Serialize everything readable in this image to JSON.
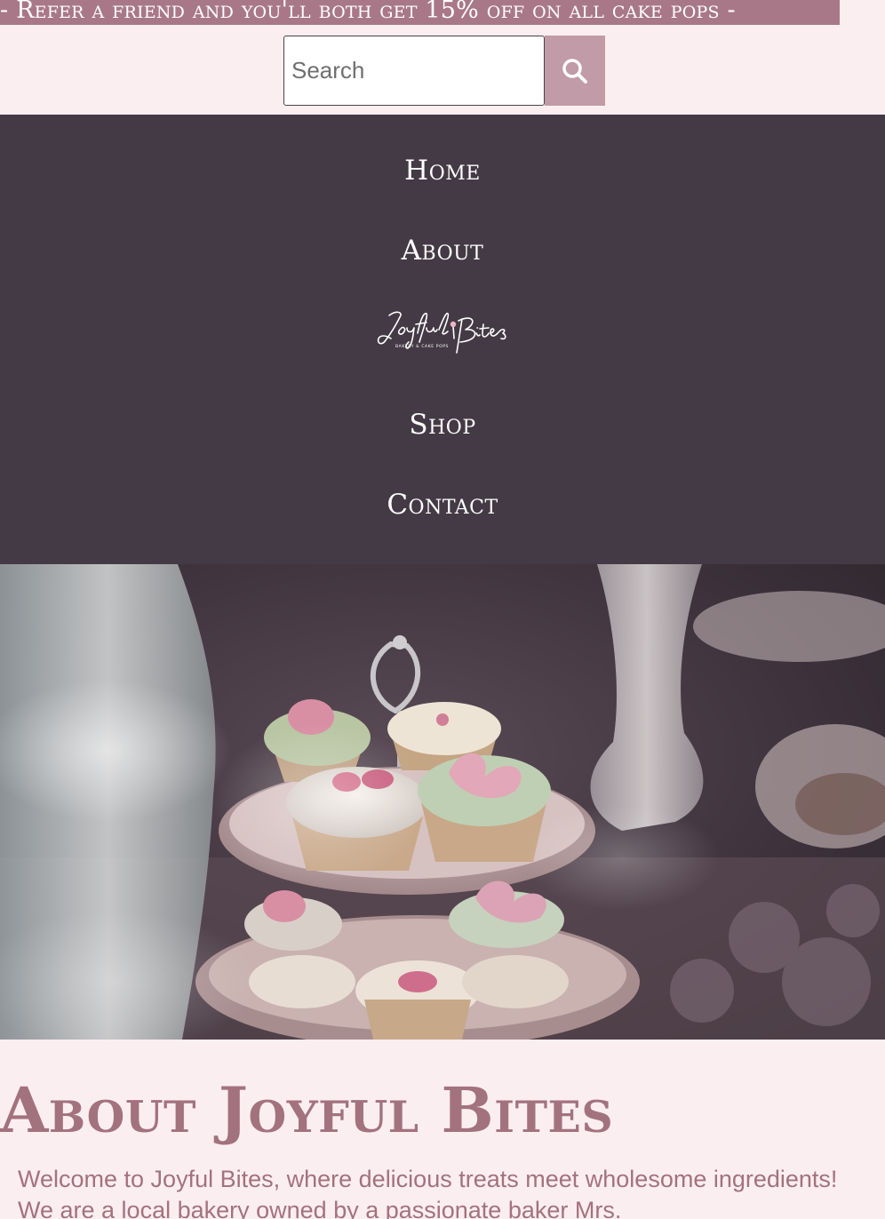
{
  "promo": {
    "text": "- Refer a friend and you'll both get 15% off on all cake pops -"
  },
  "search": {
    "placeholder": "Search",
    "value": "",
    "button_icon": "search-icon"
  },
  "nav": {
    "items": [
      {
        "label": "Home"
      },
      {
        "label": "About"
      },
      {
        "label": "Shop"
      },
      {
        "label": "Contact"
      }
    ],
    "logo": {
      "brand": "Joyful Bites",
      "tagline": "BAKERY & CAKE POPS"
    }
  },
  "hero": {
    "image": "tiered-cupcake-stand-photo"
  },
  "about": {
    "title": "About Joyful Bites",
    "text": "Welcome to Joyful Bites, where delicious treats meet wholesome ingredients! We are a local bakery owned by a passionate baker Mrs."
  },
  "colors": {
    "page_bg": "#fbeef1",
    "promo_bg": "#a87889",
    "nav_bg": "#443a45",
    "accent": "#a3727f",
    "search_button": "#c19ba7"
  }
}
